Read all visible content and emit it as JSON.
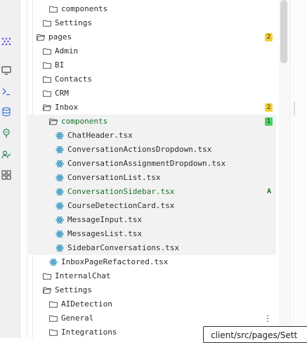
{
  "activity_bar": {
    "icons": [
      "grid-dots-icon",
      "monitor-icon",
      "terminal-icon",
      "database-icon",
      "tree-icon",
      "user-check-icon",
      "apps-icon"
    ]
  },
  "tree": {
    "rows": [
      {
        "label": "components",
        "type": "folder",
        "status": ""
      },
      {
        "label": "Settings",
        "type": "folder",
        "status": ""
      },
      {
        "label": "pages",
        "type": "folder-open",
        "badge": "2",
        "status": "git-modified"
      },
      {
        "label": "Admin",
        "type": "folder",
        "status": ""
      },
      {
        "label": "BI",
        "type": "folder",
        "status": ""
      },
      {
        "label": "Contacts",
        "type": "folder",
        "status": ""
      },
      {
        "label": "CRM",
        "type": "folder",
        "status": ""
      },
      {
        "label": "Inbox",
        "type": "folder-open",
        "badge": "2",
        "status": "git-modified"
      },
      {
        "label": "components",
        "type": "folder-open",
        "badge": "1",
        "status": "git-added"
      },
      {
        "label": "ChatHeader.tsx",
        "type": "react",
        "status": ""
      },
      {
        "label": "ConversationActionsDropdown.tsx",
        "type": "react",
        "status": ""
      },
      {
        "label": "ConversationAssignmentDropdown.tsx",
        "type": "react",
        "status": ""
      },
      {
        "label": "ConversationList.tsx",
        "type": "react",
        "status": ""
      },
      {
        "label": "ConversationSidebar.tsx",
        "type": "react",
        "letter": "A",
        "status": "git-added"
      },
      {
        "label": "CourseDetectionCard.tsx",
        "type": "react",
        "status": ""
      },
      {
        "label": "MessageInput.tsx",
        "type": "react",
        "status": ""
      },
      {
        "label": "MessagesList.tsx",
        "type": "react",
        "status": ""
      },
      {
        "label": "SidebarConversations.tsx",
        "type": "react",
        "status": ""
      },
      {
        "label": "InboxPageRefactored.tsx",
        "type": "react",
        "status": ""
      },
      {
        "label": "InternalChat",
        "type": "folder",
        "status": ""
      },
      {
        "label": "Settings",
        "type": "folder-open",
        "status": ""
      },
      {
        "label": "AIDetection",
        "type": "folder",
        "status": ""
      },
      {
        "label": "General",
        "type": "folder",
        "status": ""
      },
      {
        "label": "Integrations",
        "type": "folder",
        "status": ""
      }
    ]
  },
  "tooltip": {
    "text": "client/src/pages/Sett"
  },
  "colors": {
    "added": "#1b6e2a",
    "modified_badge": "#f2cf3c",
    "added_badge": "#4fcf68",
    "react_icon": "#1f8fbf"
  }
}
